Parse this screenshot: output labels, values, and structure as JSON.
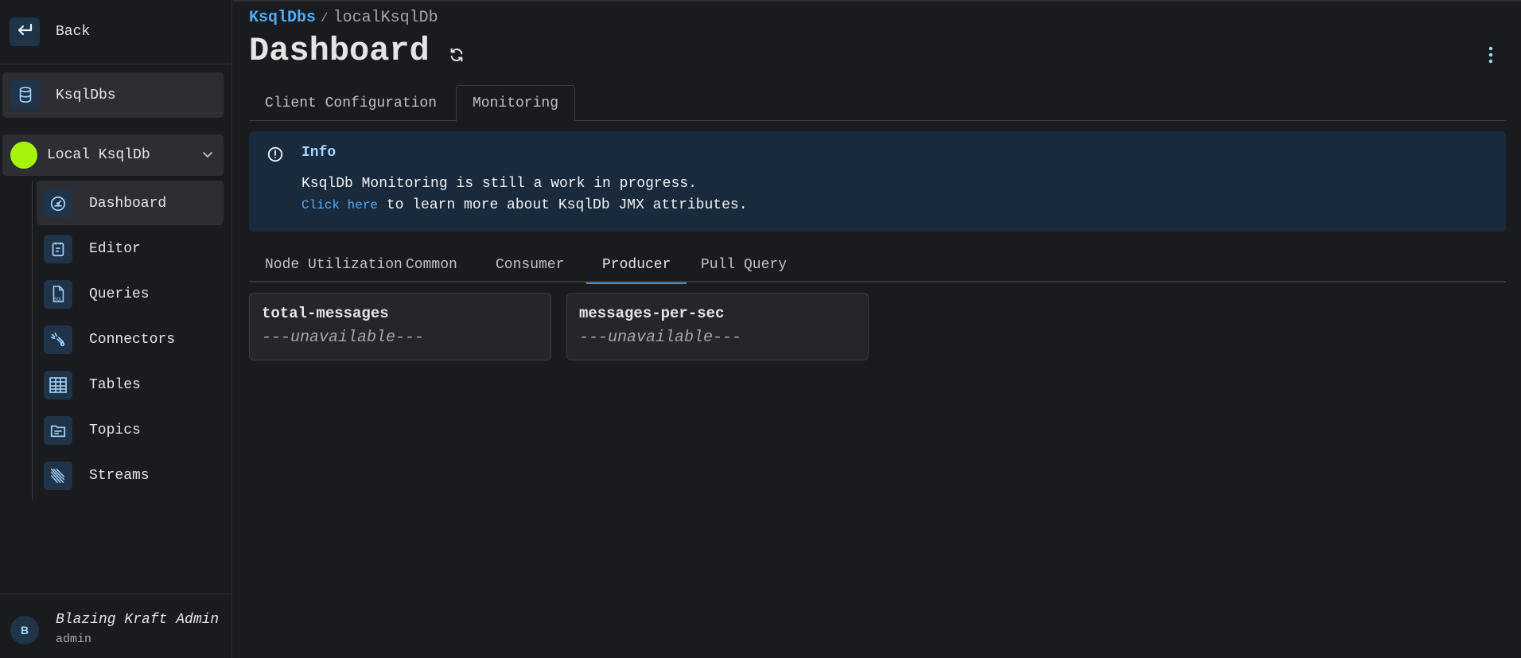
{
  "sidebar": {
    "back_label": "Back",
    "top_item": {
      "label": "KsqlDbs",
      "icon": "database-icon"
    },
    "cluster": {
      "label": "Local KsqlDb",
      "status_color": "#a6f30b"
    },
    "items": [
      {
        "label": "Dashboard",
        "icon": "gauge-icon",
        "active": true
      },
      {
        "label": "Editor",
        "icon": "notes-icon"
      },
      {
        "label": "Queries",
        "icon": "sql-file-icon"
      },
      {
        "label": "Connectors",
        "icon": "plug-icon"
      },
      {
        "label": "Tables",
        "icon": "table-icon"
      },
      {
        "label": "Topics",
        "icon": "folder-icon"
      },
      {
        "label": "Streams",
        "icon": "streams-icon"
      }
    ],
    "user": {
      "initial": "B",
      "name": "Blazing Kraft Admin",
      "role": "admin"
    }
  },
  "breadcrumb": {
    "parent": "KsqlDbs",
    "separator": "/",
    "current": "localKsqlDb"
  },
  "page": {
    "title": "Dashboard"
  },
  "tabs": [
    {
      "label": "Client Configuration",
      "active": false
    },
    {
      "label": "Monitoring",
      "active": true
    }
  ],
  "info": {
    "title": "Info",
    "line1": "KsqlDb Monitoring is still a work in progress.",
    "link_text": "Click here",
    "line2_rest": " to learn more about KsqlDb JMX attributes."
  },
  "metric_tabs": [
    {
      "label": "Node Utilization",
      "active": false
    },
    {
      "label": "Common",
      "active": false
    },
    {
      "label": "Consumer",
      "active": false
    },
    {
      "label": "Producer",
      "active": true
    },
    {
      "label": "Pull Query",
      "active": false
    }
  ],
  "metrics": [
    {
      "name": "total-messages",
      "value": "---unavailable---"
    },
    {
      "name": "messages-per-sec",
      "value": "---unavailable---"
    }
  ],
  "colors": {
    "accent": "#339af0",
    "link": "#4dabf7",
    "info_bg": "#1a2a3d",
    "icon_bg": "#1f3349"
  }
}
